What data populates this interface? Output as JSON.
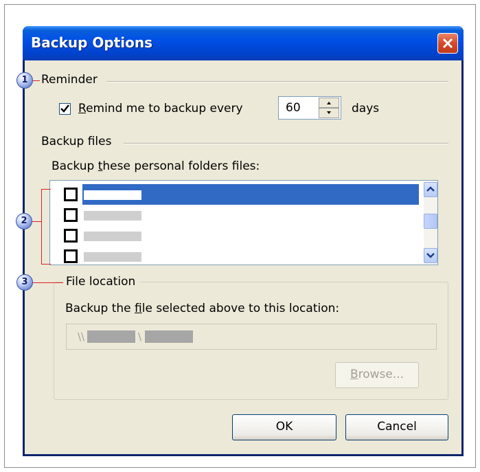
{
  "window": {
    "title": "Backup Options",
    "close_label": "×"
  },
  "callouts": [
    "1",
    "2",
    "3"
  ],
  "reminder": {
    "group_label": "Reminder",
    "checkbox_checked": true,
    "checkbox_label_accel": "R",
    "checkbox_label_rest": "emind me to backup every",
    "days_value": "60",
    "days_suffix": "days"
  },
  "backup_files": {
    "group_label": "Backup files",
    "list_label_pre": "Backup ",
    "list_label_accel": "t",
    "list_label_post": "hese personal folders files:",
    "rows": [
      {
        "checked": false,
        "selected": true
      },
      {
        "checked": false,
        "selected": false
      },
      {
        "checked": false,
        "selected": false
      },
      {
        "checked": false,
        "selected": false
      }
    ]
  },
  "file_location": {
    "group_label": "File location",
    "desc_pre": "Backup the ",
    "desc_accel": "f",
    "desc_post": "ile selected above to this location:",
    "path_sep1": "\\\\",
    "path_sep2": "\\",
    "browse_accel": "B",
    "browse_rest": "rowse..."
  },
  "buttons": {
    "ok": "OK",
    "cancel": "Cancel"
  },
  "colors": {
    "titlebar": "#0050e6",
    "selection": "#316ac5",
    "callout_bracket": "#dd2222",
    "dialog_bg": "#ece9d8"
  }
}
